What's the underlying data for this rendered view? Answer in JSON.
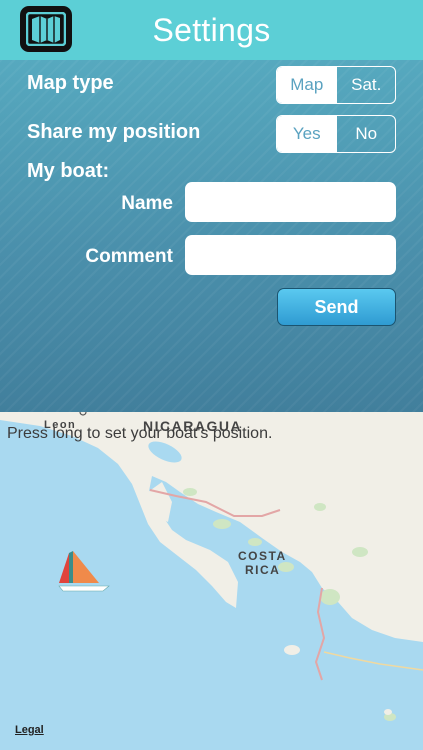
{
  "header": {
    "title": "Settings",
    "map_icon": "folded-map-icon"
  },
  "settings": {
    "map_type": {
      "label": "Map type",
      "options": [
        "Map",
        "Sat."
      ],
      "selected": "Map"
    },
    "share_position": {
      "label": "Share my position",
      "options": [
        "Yes",
        "No"
      ],
      "selected": "Yes"
    },
    "my_boat": {
      "label": "My boat:",
      "name": {
        "label": "Name",
        "value": "",
        "placeholder": ""
      },
      "comment": {
        "label": "Comment",
        "value": "",
        "placeholder": ""
      }
    },
    "send_label": "Send"
  },
  "map": {
    "hint": "Press long to set your boat's position.",
    "place_labels": {
      "country1": "NICARAGUA",
      "country2_line1": "COSTA",
      "country2_line2": "RICA",
      "city": "Leon"
    },
    "legal": "Legal",
    "boat_icon": "sailboat-icon"
  },
  "colors": {
    "header": "#5ccfd6",
    "panel": "#4f99b2",
    "sea": "#a9d9f0",
    "land": "#f1efe7",
    "send_button": "#3aaee2"
  }
}
